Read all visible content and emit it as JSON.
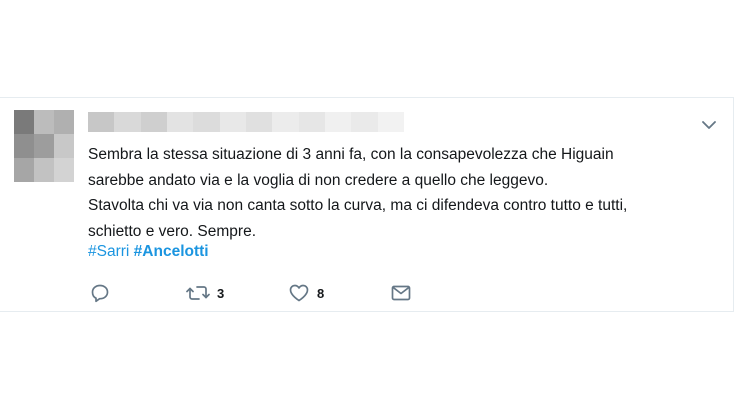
{
  "tweet": {
    "text": "Sembra la stessa situazione di 3 anni fa, con la consapevolezza che Higuain\nsarebbe andato via e la voglia di non credere a quello che leggevo.\nStavolta chi va via non canta sotto la curva, ma ci difendeva contro tutto e tutti,\nschietto e vero. Sempre.",
    "hashtags": [
      "#Sarri",
      "#Ancelotti"
    ]
  },
  "actions": {
    "reply": {
      "icon": "reply-icon"
    },
    "retweet": {
      "icon": "retweet-icon",
      "count": "3"
    },
    "like": {
      "icon": "heart-icon",
      "count": "8"
    },
    "dm": {
      "icon": "envelope-icon"
    }
  },
  "colors": {
    "text": "#14171a",
    "link": "#1b95e0",
    "icon": "#657786",
    "border": "#e6ecf0"
  }
}
